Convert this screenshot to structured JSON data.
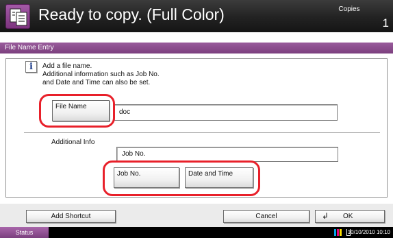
{
  "header": {
    "title": "Ready to copy. (Full Color)",
    "copies_label": "Copies",
    "copies_count": "1",
    "app_icon": "copy-documents-icon"
  },
  "panel": {
    "title": "File Name Entry",
    "info": {
      "icon": "info-icon",
      "lines": [
        "Add a file name.",
        "Additional information such as Job No.",
        "and Date and Time can also be set."
      ]
    },
    "file_name": {
      "button_label": "File Name",
      "value": "doc"
    },
    "additional_info": {
      "label": "Additional Info",
      "value": "Job No.",
      "job_no_label": "Job No.",
      "date_time_label": "Date and Time"
    }
  },
  "footer": {
    "add_shortcut_label": "Add Shortcut",
    "cancel_label": "Cancel",
    "ok_label": "OK",
    "ok_icon": "enter-icon"
  },
  "status_bar": {
    "status_label": "Status",
    "datetime": "10/10/2010 10:10",
    "toner_icon": "toner-level-icon"
  },
  "colors": {
    "accent_purple": "#8a4a8d",
    "highlight_red": "#e8202a",
    "header_bg": "#2a2a2a"
  }
}
